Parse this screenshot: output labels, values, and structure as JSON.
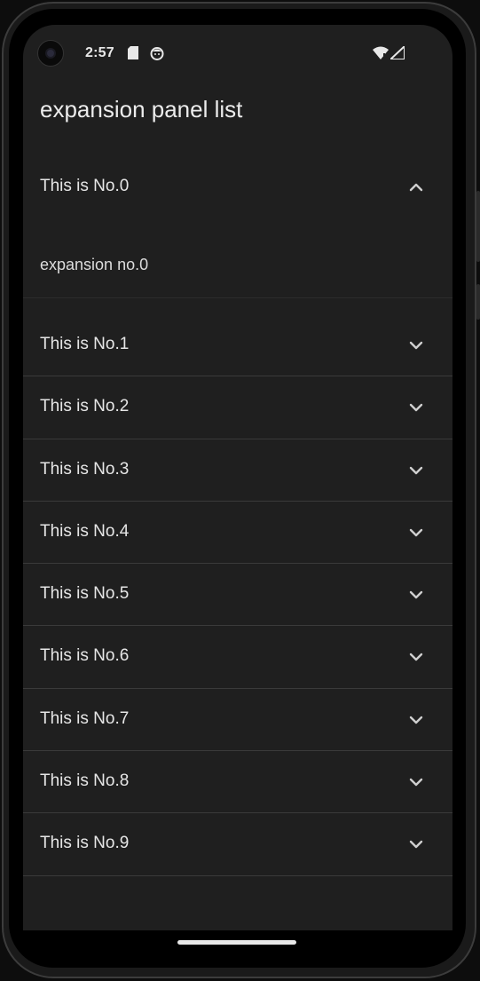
{
  "status_bar": {
    "time": "2:57",
    "icons": [
      "sd-card-icon",
      "face-icon",
      "wifi-icon",
      "signal-icon"
    ]
  },
  "app_bar": {
    "title": "expansion panel list"
  },
  "panels": [
    {
      "header": "This is No.0",
      "expanded": true,
      "body": "expansion no.0"
    },
    {
      "header": "This is No.1",
      "expanded": false
    },
    {
      "header": "This is No.2",
      "expanded": false
    },
    {
      "header": "This is No.3",
      "expanded": false
    },
    {
      "header": "This is No.4",
      "expanded": false
    },
    {
      "header": "This is No.5",
      "expanded": false
    },
    {
      "header": "This is No.6",
      "expanded": false
    },
    {
      "header": "This is No.7",
      "expanded": false
    },
    {
      "header": "This is No.8",
      "expanded": false
    },
    {
      "header": "This is No.9",
      "expanded": false
    }
  ],
  "colors": {
    "background": "#1f1f1f",
    "text": "#e6e6e6",
    "divider": "#3a3a3a"
  }
}
